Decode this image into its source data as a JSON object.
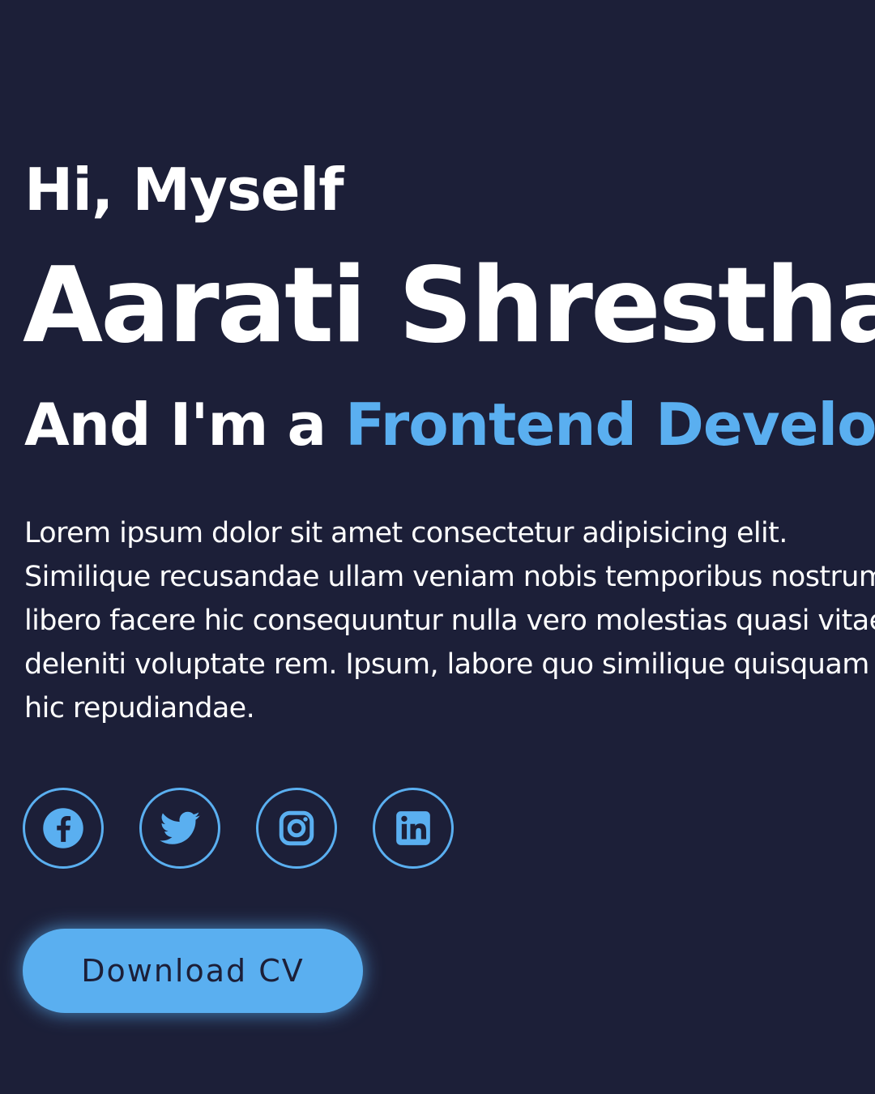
{
  "hero": {
    "greeting": "Hi, Myself",
    "name": "Aarati Shrestha",
    "role_prefix": "And I'm a ",
    "role_highlight": "Frontend Developer",
    "description_lines": [
      "Lorem ipsum dolor sit amet consectetur adipisicing elit.",
      "Similique recusandae ullam veniam nobis temporibus nostrum",
      "libero facere hic consequuntur nulla vero molestias quasi vitae",
      "deleniti voluptate rem. Ipsum, labore quo similique quisquam",
      "hic repudiandae."
    ],
    "socials": [
      {
        "icon": "facebook-icon"
      },
      {
        "icon": "twitter-icon"
      },
      {
        "icon": "instagram-icon"
      },
      {
        "icon": "linkedin-icon"
      }
    ],
    "cta_label": "Download CV"
  },
  "colors": {
    "background": "#1c1f38",
    "text": "#ffffff",
    "accent": "#5aaff0"
  }
}
